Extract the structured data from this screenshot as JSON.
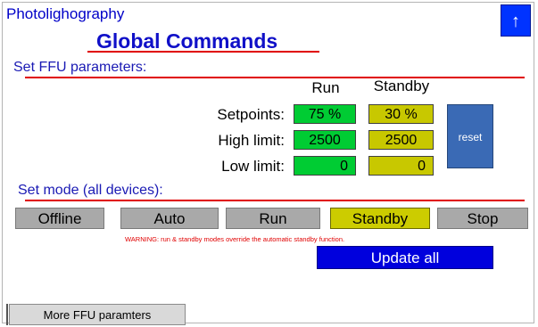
{
  "header": {
    "app_name": "Photolighography",
    "title": "Global Commands",
    "up_icon": "↑"
  },
  "ffu": {
    "section_label": "Set FFU parameters:",
    "col_run": "Run",
    "col_standby": "Standby",
    "rows": [
      {
        "label": "Setpoints:",
        "run": "75 %",
        "standby": "30 %"
      },
      {
        "label": "High limit:",
        "run": "2500",
        "standby": "2500"
      },
      {
        "label": "Low limit:",
        "run": "0",
        "standby": "0"
      }
    ],
    "reset_label": "reset"
  },
  "mode": {
    "section_label": "Set mode (all devices):",
    "buttons": [
      "Offline",
      "Auto",
      "Run",
      "Standby",
      "Stop"
    ],
    "active": "Standby",
    "warning": "WARNING: run & standby modes override the automatic standby function.",
    "update_label": "Update all"
  },
  "footer": {
    "more_label": "More FFU paramters"
  },
  "colors": {
    "run_green": "#00cc33",
    "standby_yellow": "#c8c800",
    "accent_blue": "#0000dd",
    "rule_red": "#e00000"
  }
}
